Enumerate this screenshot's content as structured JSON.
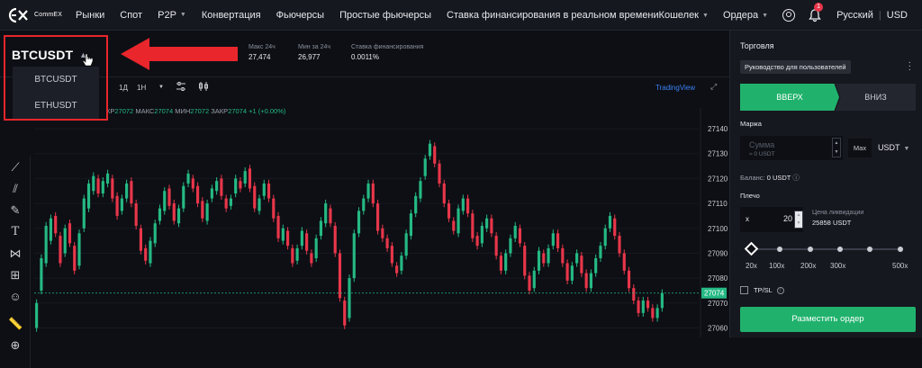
{
  "brand": {
    "name": "CommEX"
  },
  "nav": {
    "items": [
      {
        "label": "Рынки"
      },
      {
        "label": "Спот"
      },
      {
        "label": "P2P"
      },
      {
        "label": "Конвертация"
      },
      {
        "label": "Фьючерсы"
      },
      {
        "label": "Простые фьючерсы"
      },
      {
        "label": "Ставка финансирования в реальном времени"
      }
    ]
  },
  "topright": {
    "wallet": "Кошелек",
    "orders": "Ордера",
    "notifications": "1",
    "language": "Русский",
    "currency": "USD"
  },
  "market": {
    "pair": "BTCUSDT",
    "high_label": "Макс 24ч",
    "high_value": "27,474",
    "low_label": "Мин за 24ч",
    "low_value": "26,977",
    "funding_label": "Ставка финансирования",
    "funding_value": "0.0011%"
  },
  "dropdown": {
    "items": [
      "BTCUSDT",
      "ETHUSDT"
    ]
  },
  "toolbar": {
    "interval_1d": "1Д",
    "interval_1h": "1Н",
    "tradingview": "TradingView"
  },
  "ohlc": {
    "close_partial": "КР",
    "open_val": "27072",
    "high_label": "МАКС",
    "high_val": "27074",
    "low_label": "МИН",
    "low_val": "27072",
    "close_label": "ЗАКР",
    "close_val": "27074",
    "change": "+1 (+0.00%)"
  },
  "colors": {
    "up": "#25b984",
    "down": "#e8364a",
    "accent": "#20b26c",
    "annotation": "#e8262c"
  },
  "chart_data": {
    "type": "candlestick",
    "y_ticks": [
      27140,
      27130,
      27120,
      27110,
      27100,
      27090,
      27080,
      27070,
      27060
    ],
    "ylim": [
      27058,
      27144
    ],
    "last_price": "27074",
    "candles": [
      [
        27060,
        27070
      ],
      [
        27075,
        27088
      ],
      [
        27086,
        27101
      ],
      [
        27095,
        27104
      ],
      [
        27105,
        27098
      ],
      [
        27097,
        27086
      ],
      [
        27090,
        27100
      ],
      [
        27102,
        27094
      ],
      [
        27093,
        27083
      ],
      [
        27085,
        27098
      ],
      [
        27100,
        27112
      ],
      [
        27108,
        27118
      ],
      [
        27115,
        27121
      ],
      [
        27120,
        27114
      ],
      [
        27114,
        27119
      ],
      [
        27118,
        27122
      ],
      [
        27120,
        27112
      ],
      [
        27113,
        27105
      ],
      [
        27107,
        27112
      ],
      [
        27112,
        27118
      ],
      [
        27119,
        27110
      ],
      [
        27110,
        27101
      ],
      [
        27100,
        27091
      ],
      [
        27092,
        27087
      ],
      [
        27086,
        27095
      ],
      [
        27094,
        27102
      ],
      [
        27103,
        27108
      ],
      [
        27107,
        27115
      ],
      [
        27116,
        27109
      ],
      [
        27110,
        27103
      ],
      [
        27102,
        27108
      ],
      [
        27108,
        27117
      ],
      [
        27118,
        27122
      ],
      [
        27120,
        27116
      ],
      [
        27117,
        27110
      ],
      [
        27111,
        27104
      ],
      [
        27103,
        27110
      ],
      [
        27112,
        27116
      ],
      [
        27115,
        27119
      ],
      [
        27120,
        27113
      ],
      [
        27112,
        27108
      ],
      [
        27109,
        27112
      ],
      [
        27114,
        27120
      ],
      [
        27119,
        27116
      ],
      [
        27118,
        27123
      ],
      [
        27124,
        27116
      ],
      [
        27117,
        27108
      ],
      [
        27107,
        27112
      ],
      [
        27113,
        27118
      ],
      [
        27118,
        27112
      ],
      [
        27112,
        27104
      ],
      [
        27105,
        27096
      ],
      [
        27095,
        27100
      ],
      [
        27099,
        27093
      ],
      [
        27092,
        27086
      ],
      [
        27087,
        27092
      ],
      [
        27093,
        27099
      ],
      [
        27098,
        27091
      ],
      [
        27090,
        27086
      ],
      [
        27088,
        27096
      ],
      [
        27097,
        27103
      ],
      [
        27102,
        27110
      ],
      [
        27108,
        27102
      ],
      [
        27101,
        27090
      ],
      [
        27090,
        27072
      ],
      [
        27071,
        27061
      ],
      [
        27064,
        27080
      ],
      [
        27080,
        27098
      ],
      [
        27098,
        27107
      ],
      [
        27107,
        27112
      ],
      [
        27112,
        27118
      ],
      [
        27118,
        27110
      ],
      [
        27110,
        27099
      ],
      [
        27100,
        27096
      ],
      [
        27096,
        27092
      ],
      [
        27093,
        27086
      ],
      [
        27085,
        27082
      ],
      [
        27083,
        27089
      ],
      [
        27089,
        27098
      ],
      [
        27097,
        27106
      ],
      [
        27106,
        27113
      ],
      [
        27112,
        27119
      ],
      [
        27121,
        27128
      ],
      [
        27129,
        27134
      ],
      [
        27133,
        27126
      ],
      [
        27126,
        27118
      ],
      [
        27118,
        27110
      ],
      [
        27110,
        27104
      ],
      [
        27103,
        27099
      ],
      [
        27098,
        27108
      ],
      [
        27107,
        27112
      ],
      [
        27112,
        27106
      ],
      [
        27106,
        27096
      ],
      [
        27097,
        27093
      ],
      [
        27094,
        27101
      ],
      [
        27100,
        27104
      ],
      [
        27104,
        27098
      ],
      [
        27097,
        27089
      ],
      [
        27089,
        27083
      ],
      [
        27083,
        27090
      ],
      [
        27090,
        27096
      ],
      [
        27096,
        27101
      ],
      [
        27100,
        27094
      ],
      [
        27093,
        27081
      ],
      [
        27081,
        27075
      ],
      [
        27076,
        27083
      ],
      [
        27083,
        27091
      ],
      [
        27090,
        27086
      ],
      [
        27086,
        27092
      ],
      [
        27093,
        27098
      ],
      [
        27098,
        27092
      ],
      [
        27092,
        27086
      ],
      [
        27086,
        27079
      ],
      [
        27079,
        27085
      ],
      [
        27086,
        27090
      ],
      [
        27089,
        27082
      ],
      [
        27082,
        27076
      ],
      [
        27076,
        27082
      ],
      [
        27082,
        27088
      ],
      [
        27088,
        27093
      ],
      [
        27093,
        27100
      ],
      [
        27100,
        27105
      ],
      [
        27104,
        27097
      ],
      [
        27097,
        27090
      ],
      [
        27090,
        27083
      ],
      [
        27083,
        27076
      ],
      [
        27076,
        27071
      ],
      [
        27071,
        27066
      ],
      [
        27066,
        27071
      ],
      [
        27071,
        27068
      ],
      [
        27068,
        27064
      ],
      [
        27064,
        27068
      ],
      [
        27068,
        27074
      ]
    ]
  },
  "trade": {
    "title": "Торговля",
    "guide": "Руководство для пользователей",
    "tab_up": "ВВЕРХ",
    "tab_down": "ВНИЗ",
    "margin_label": "Маржа",
    "amount_placeholder": "Сумма",
    "amount_sub": "≈ 0 USDT",
    "max": "Max",
    "currency": "USDT",
    "balance_label": "Баланс:",
    "balance_value": "0 USDT",
    "leverage_label": "Плечо",
    "leverage_prefix": "x",
    "leverage_value": "20",
    "liq_label": "Цена ликвидации",
    "liq_value": "25858 USDT",
    "lev_ticks": [
      "20x",
      "100x",
      "200x",
      "300x",
      "500x"
    ],
    "tpsl": "TP/SL",
    "place_order": "Разместить ордер"
  }
}
